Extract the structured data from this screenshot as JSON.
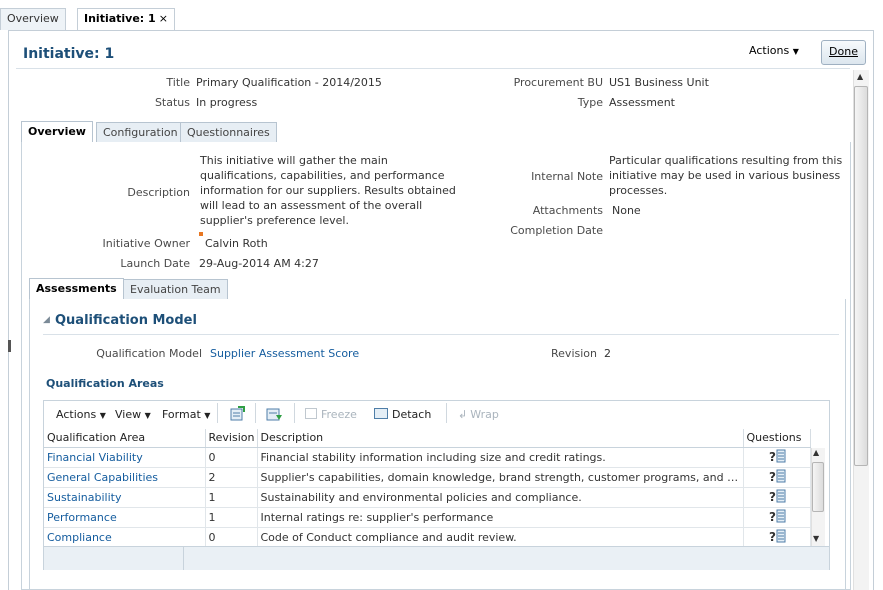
{
  "top_tabs": [
    {
      "label": "Overview"
    },
    {
      "label": "Initiative: 1",
      "close": "×"
    }
  ],
  "page": {
    "title": "Initiative: 1",
    "actions_label": "Actions",
    "done_label": "Done"
  },
  "header_fields": {
    "title_label": "Title",
    "title_value": "Primary Qualification - 2014/2015",
    "status_label": "Status",
    "status_value": "In progress",
    "bu_label": "Procurement BU",
    "bu_value": "US1 Business Unit",
    "type_label": "Type",
    "type_value": "Assessment"
  },
  "inner_tabs": [
    "Overview",
    "Configuration",
    "Questionnaires"
  ],
  "overview": {
    "description_label": "Description",
    "description_lines": [
      "This initiative will gather the main",
      "qualifications, capabilities, and performance",
      "information for our suppliers. Results obtained",
      "will lead to an assessment of the overall",
      "supplier's preference level."
    ],
    "owner_label": "Initiative Owner",
    "owner_value": "Calvin Roth",
    "launch_label": "Launch Date",
    "launch_value": "29-Aug-2014 AM 4:27",
    "internal_note_label": "Internal Note",
    "internal_note_lines": [
      "Particular qualifications resulting from this",
      "initiative may be used in various business",
      "processes."
    ],
    "attachments_label": "Attachments",
    "attachments_value": "None",
    "completion_label": "Completion Date"
  },
  "sub_tabs": [
    "Assessments",
    "Evaluation Team"
  ],
  "qual_model": {
    "section_title": "Qualification Model",
    "model_label": "Qualification Model",
    "model_value": "Supplier Assessment Score",
    "revision_label": "Revision",
    "revision_value": "2",
    "areas_title": "Qualification Areas"
  },
  "toolbar": {
    "actions": "Actions",
    "view": "View",
    "format": "Format",
    "freeze": "Freeze",
    "detach": "Detach",
    "wrap": "Wrap"
  },
  "table": {
    "columns": [
      "Qualification Area",
      "Revision",
      "Description",
      "Questions"
    ],
    "rows": [
      {
        "area": "Financial Viability",
        "revision": "0",
        "description": "Financial stability information including size and credit ratings."
      },
      {
        "area": "General Capabilities",
        "revision": "2",
        "description": "Supplier's capabilities, domain knowledge, brand strength, customer programs, and governan..."
      },
      {
        "area": "Sustainability",
        "revision": "1",
        "description": "Sustainability and environmental policies and compliance."
      },
      {
        "area": "Performance",
        "revision": "1",
        "description": "Internal ratings re: supplier's performance"
      },
      {
        "area": "Compliance",
        "revision": "0",
        "description": "Code of Conduct compliance and audit review."
      }
    ]
  },
  "colors": {
    "link": "#145c9e",
    "title": "#1d4f78",
    "border": "#c4ced7"
  }
}
